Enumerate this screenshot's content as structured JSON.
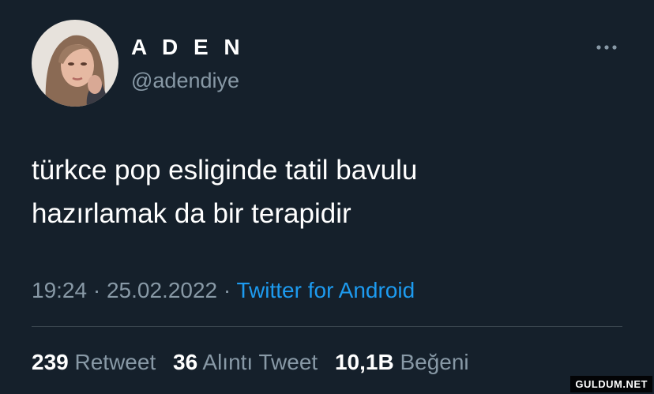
{
  "header": {
    "display_name": "A D E N",
    "handle": "@adendiye"
  },
  "tweet": {
    "text_line_1": "türkce pop esliginde tatil bavulu",
    "text_line_2": "hazırlamak da bir terapidir"
  },
  "meta": {
    "time": "19:24",
    "separator": "·",
    "date": "25.02.2022",
    "source": "Twitter for Android"
  },
  "stats": {
    "retweets_count": "239",
    "retweets_label": "Retweet",
    "quotes_count": "36",
    "quotes_label": "Alıntı Tweet",
    "likes_count": "10,1B",
    "likes_label": "Beğeni"
  },
  "watermark": "GULDUM.NET",
  "icons": {
    "more": "more-horizontal-icon"
  },
  "colors": {
    "background": "#15202b",
    "accent": "#1d9bf0",
    "secondary_text": "#8899a6"
  }
}
